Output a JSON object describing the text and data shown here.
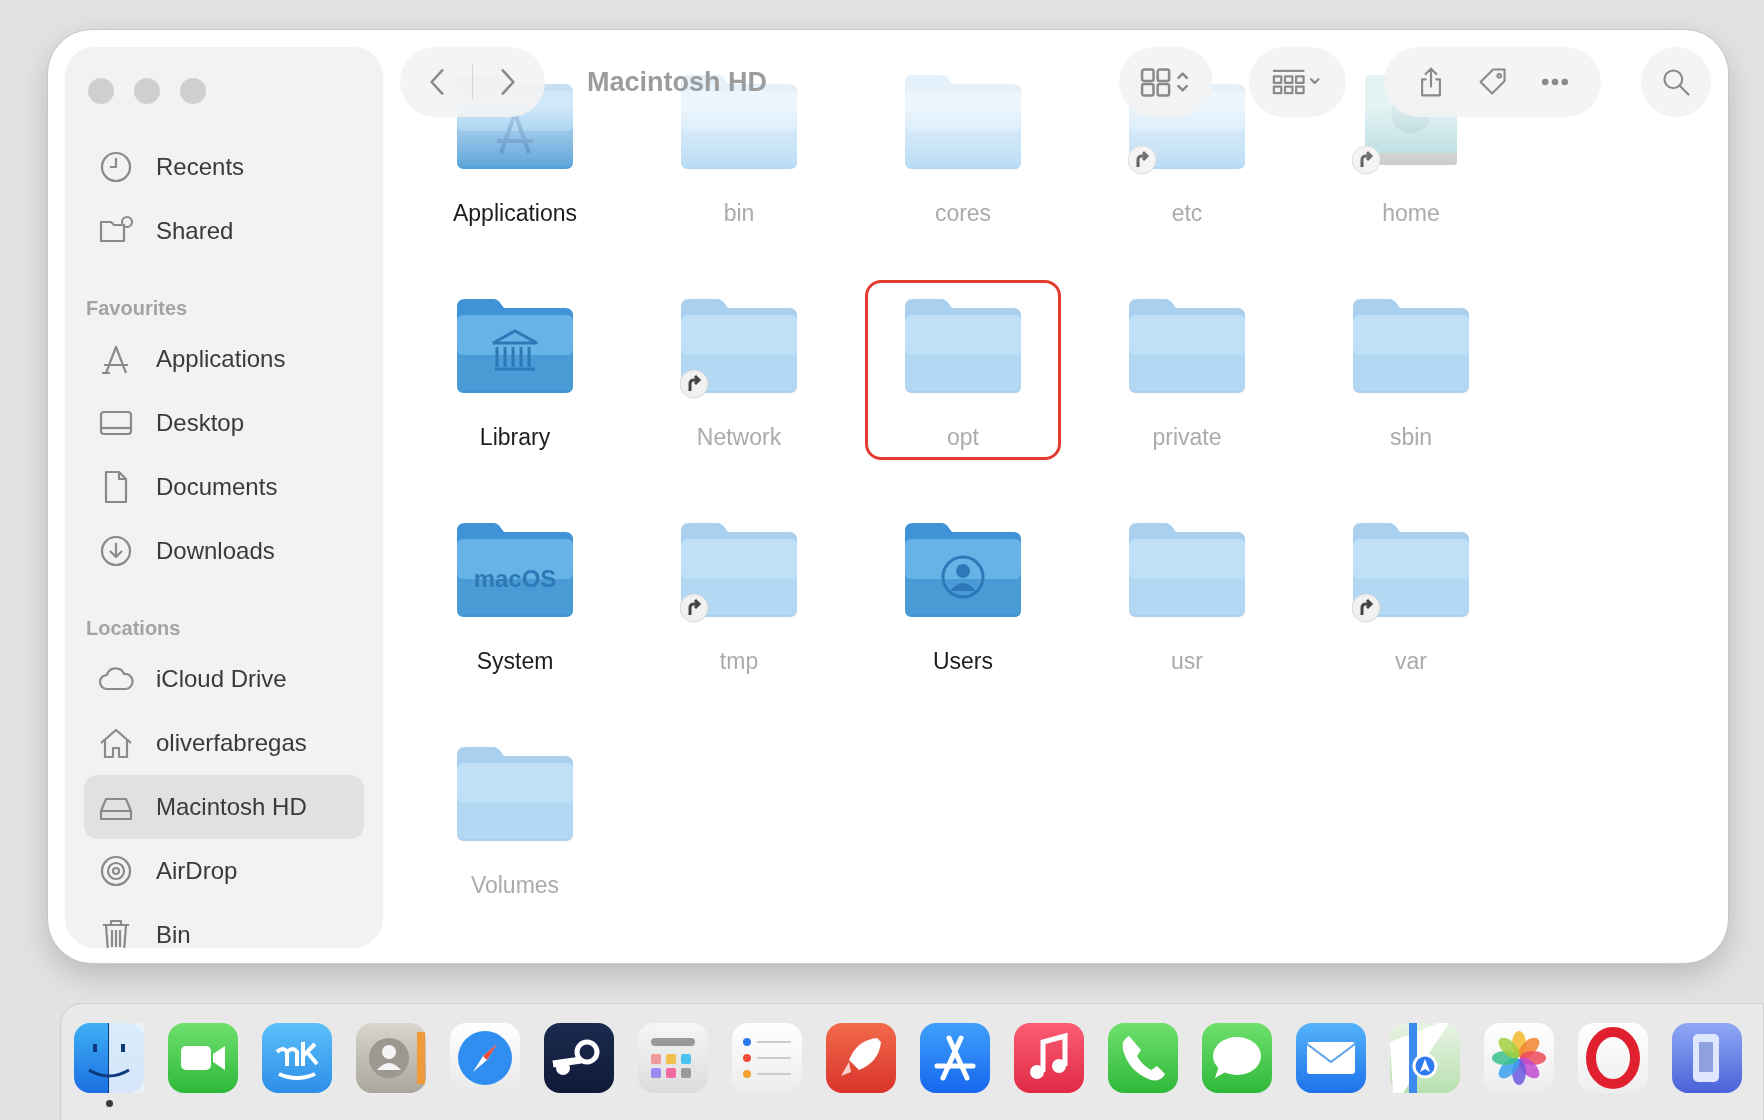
{
  "window": {
    "title": "Macintosh HD"
  },
  "sidebar": {
    "sections": [
      {
        "items": [
          {
            "label": "Recents",
            "selected": false
          },
          {
            "label": "Shared",
            "selected": false
          }
        ]
      },
      {
        "heading": "Favourites",
        "items": [
          {
            "label": "Applications",
            "selected": false
          },
          {
            "label": "Desktop",
            "selected": false
          },
          {
            "label": "Documents",
            "selected": false
          },
          {
            "label": "Downloads",
            "selected": false
          }
        ]
      },
      {
        "heading": "Locations",
        "items": [
          {
            "label": "iCloud Drive",
            "selected": false
          },
          {
            "label": "oliverfabregas",
            "selected": false
          },
          {
            "label": "Macintosh HD",
            "selected": true
          },
          {
            "label": "AirDrop",
            "selected": false
          },
          {
            "label": "Bin",
            "selected": false
          }
        ]
      }
    ]
  },
  "files": [
    {
      "name": "Applications",
      "kind": "apps",
      "dimmed": false,
      "alias": false,
      "highlighted": false
    },
    {
      "name": "bin",
      "kind": "folder",
      "dimmed": true,
      "alias": false,
      "highlighted": false
    },
    {
      "name": "cores",
      "kind": "folder",
      "dimmed": true,
      "alias": false,
      "highlighted": false
    },
    {
      "name": "etc",
      "kind": "folder",
      "dimmed": true,
      "alias": true,
      "highlighted": false
    },
    {
      "name": "home",
      "kind": "drive",
      "dimmed": true,
      "alias": true,
      "highlighted": false
    },
    {
      "name": "Library",
      "kind": "library",
      "dimmed": false,
      "alias": false,
      "highlighted": false
    },
    {
      "name": "Network",
      "kind": "folder",
      "dimmed": true,
      "alias": true,
      "highlighted": false
    },
    {
      "name": "opt",
      "kind": "folder",
      "dimmed": true,
      "alias": false,
      "highlighted": true
    },
    {
      "name": "private",
      "kind": "folder",
      "dimmed": true,
      "alias": false,
      "highlighted": false
    },
    {
      "name": "sbin",
      "kind": "folder",
      "dimmed": true,
      "alias": false,
      "highlighted": false
    },
    {
      "name": "System",
      "kind": "system",
      "badge_text": "macOS",
      "dimmed": false,
      "alias": false,
      "highlighted": false
    },
    {
      "name": "tmp",
      "kind": "folder",
      "dimmed": true,
      "alias": true,
      "highlighted": false
    },
    {
      "name": "Users",
      "kind": "users",
      "dimmed": false,
      "alias": false,
      "highlighted": false
    },
    {
      "name": "usr",
      "kind": "folder",
      "dimmed": true,
      "alias": false,
      "highlighted": false
    },
    {
      "name": "var",
      "kind": "folder",
      "dimmed": true,
      "alias": true,
      "highlighted": false
    },
    {
      "name": "Volumes",
      "kind": "folder",
      "dimmed": true,
      "alias": false,
      "highlighted": false
    }
  ],
  "dock": {
    "apps": [
      {
        "running": true
      },
      {
        "running": false
      },
      {
        "running": false
      },
      {
        "running": false
      },
      {
        "running": false
      },
      {
        "running": false
      },
      {
        "running": false
      },
      {
        "running": false
      },
      {
        "running": false
      },
      {
        "running": false
      },
      {
        "running": false
      },
      {
        "running": false
      },
      {
        "running": false
      },
      {
        "running": false
      },
      {
        "running": false
      },
      {
        "running": false
      },
      {
        "running": false
      },
      {
        "running": false
      }
    ]
  }
}
